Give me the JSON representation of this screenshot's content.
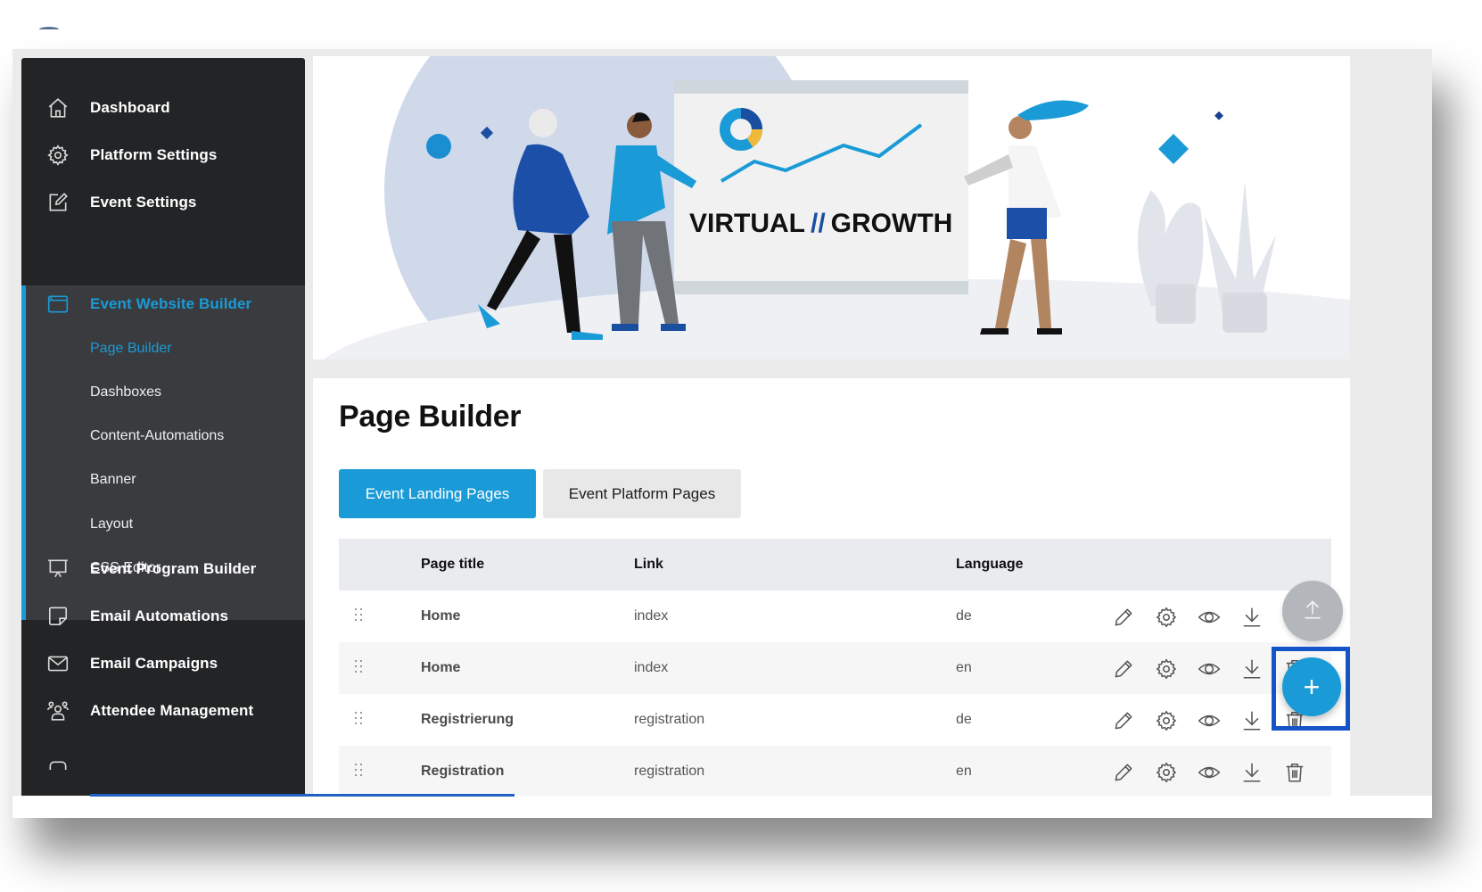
{
  "sidebar": {
    "items": [
      {
        "label": "Dashboard",
        "icon": "home-icon"
      },
      {
        "label": "Platform Settings",
        "icon": "gear-icon"
      },
      {
        "label": "Event Settings",
        "icon": "edit-icon"
      },
      {
        "label": "Event Website Builder",
        "icon": "browser-window-icon",
        "active": true
      },
      {
        "label": "Event Program Builder",
        "icon": "presentation-icon"
      },
      {
        "label": "Email Automations",
        "icon": "note-icon"
      },
      {
        "label": "Email Campaigns",
        "icon": "envelope-icon"
      },
      {
        "label": "Attendee Management",
        "icon": "users-icon"
      }
    ],
    "subitems": [
      {
        "label": "Page Builder",
        "active": true
      },
      {
        "label": "Dashboxes"
      },
      {
        "label": "Content-Automations"
      },
      {
        "label": "Banner"
      },
      {
        "label": "Layout"
      },
      {
        "label": "CSS Editor"
      }
    ]
  },
  "hero": {
    "headline_left": "VIRTUAL",
    "headline_separator": "//",
    "headline_right": "GROWTH"
  },
  "main": {
    "title": "Page Builder",
    "tabs": [
      {
        "label": "Event Landing Pages",
        "active": true
      },
      {
        "label": "Event Platform Pages",
        "active": false
      }
    ],
    "table": {
      "columns": [
        "Page title",
        "Link",
        "Language"
      ],
      "rows": [
        {
          "title": "Home",
          "link": "index",
          "language": "de"
        },
        {
          "title": "Home",
          "link": "index",
          "language": "en"
        },
        {
          "title": "Registrierung",
          "link": "registration",
          "language": "de"
        },
        {
          "title": "Registration",
          "link": "registration",
          "language": "en"
        }
      ],
      "row_actions": [
        "edit-icon",
        "settings-icon",
        "preview-eye-icon",
        "download-icon",
        "trash-icon"
      ]
    }
  },
  "fabs": {
    "scroll_top_icon": "arrow-up-icon",
    "add_label": "+"
  },
  "colors": {
    "accent": "#1a9bd7",
    "sidebar_bg": "#222426",
    "highlight_box": "#1454c8"
  }
}
